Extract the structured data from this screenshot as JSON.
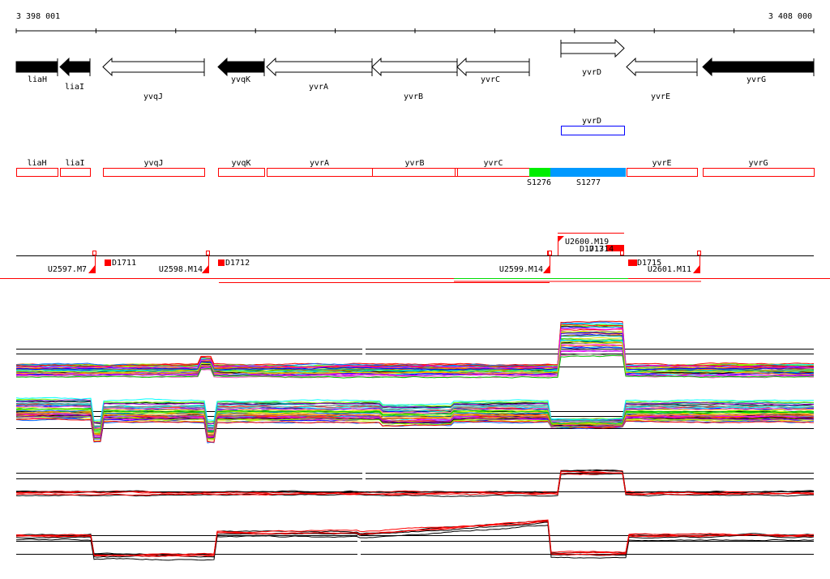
{
  "ruler": {
    "start_label": "3 398 001",
    "end_label": "3 408 000"
  },
  "genes": [
    {
      "name": "liaH",
      "strand": "-",
      "filled": true
    },
    {
      "name": "liaI",
      "strand": "-",
      "filled": true
    },
    {
      "name": "yvqJ",
      "strand": "-",
      "filled": false
    },
    {
      "name": "yvqK",
      "strand": "-",
      "filled": true
    },
    {
      "name": "yvrA",
      "strand": "-",
      "filled": false
    },
    {
      "name": "yvrB",
      "strand": "-",
      "filled": false
    },
    {
      "name": "yvrC",
      "strand": "-",
      "filled": false
    },
    {
      "name": "yvrD",
      "strand": "+",
      "filled": false
    },
    {
      "name": "yvrE",
      "strand": "-",
      "filled": false
    },
    {
      "name": "yvrG",
      "strand": "-",
      "filled": true
    }
  ],
  "annotation_box": {
    "name": "yvrD",
    "color": "#0000ff"
  },
  "gene_boxes": [
    "liaH",
    "liaI",
    "yvqJ",
    "yvqK",
    "yvrA",
    "yvrB",
    "yvrC",
    "yvrE",
    "yvrG"
  ],
  "sites": [
    {
      "name": "S1276",
      "color": "#00ee00"
    },
    {
      "name": "S1277",
      "color": "#0099ff"
    }
  ],
  "segments": {
    "upstream": [
      "U2597.M7",
      "U2598.M14",
      "U2599.M14",
      "U2600.M19",
      "U2601.M11"
    ],
    "downstream": [
      "D1711",
      "D1712",
      "D1713",
      "D1714",
      "D1715"
    ]
  },
  "colors": {
    "gene_box": "#ff0000",
    "segment": "#ff0000",
    "track_line": "#000000"
  },
  "profile_panels": 4
}
